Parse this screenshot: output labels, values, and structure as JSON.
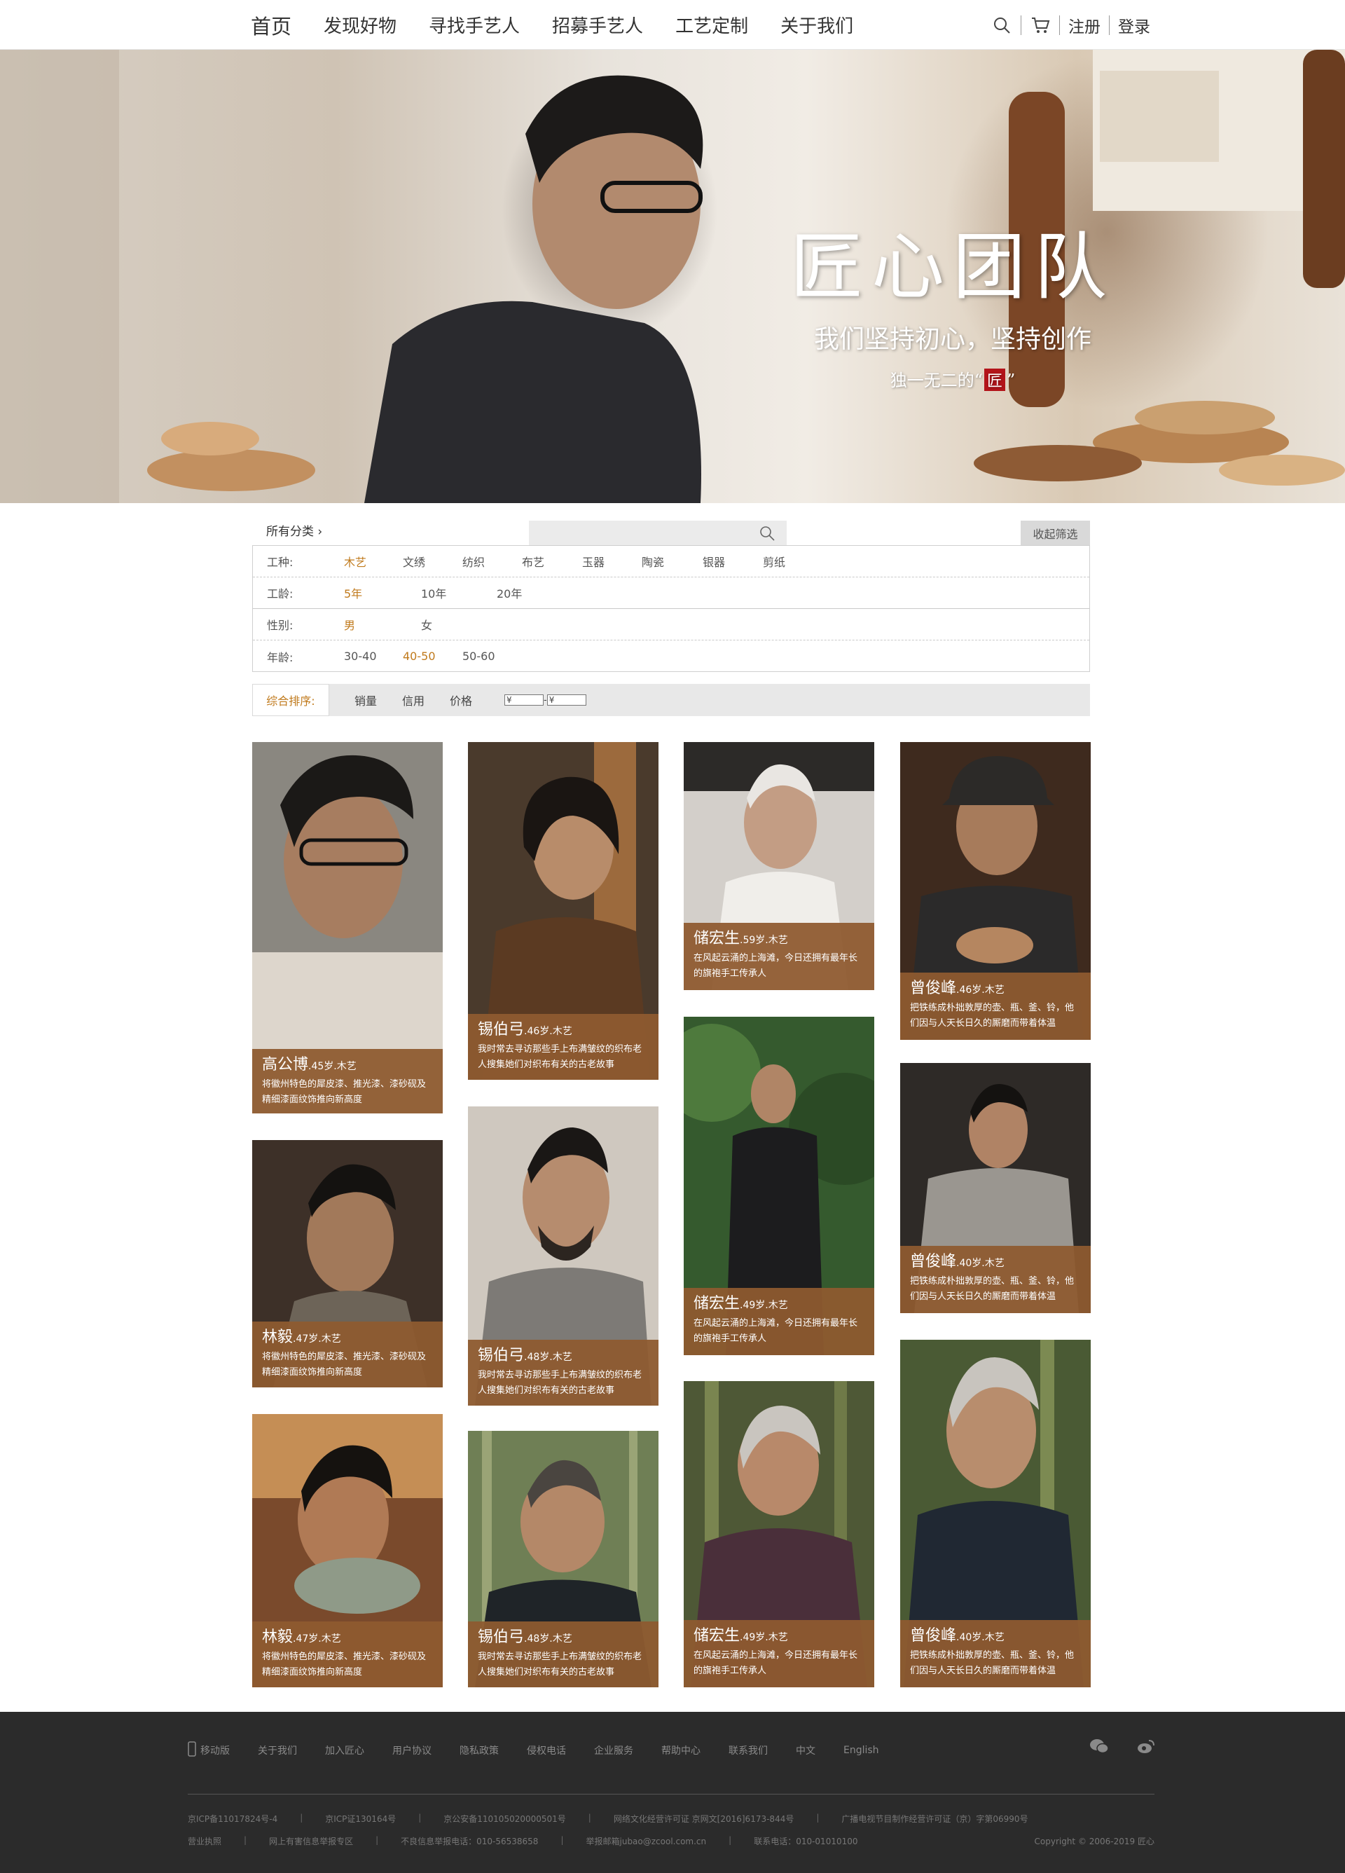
{
  "nav": {
    "items": [
      "首页",
      "发现好物",
      "寻找手艺人",
      "招募手艺人",
      "工艺定制",
      "关于我们"
    ],
    "register": "注册",
    "login": "登录"
  },
  "hero": {
    "title": "匠心团队",
    "subtitle": "我们坚持初心，坚持创作",
    "tagline_pre": "独一无二的“",
    "tagline_seal": "匠",
    "tagline_post": "”"
  },
  "filter": {
    "category_label": "所有分类",
    "search_placeholder": "",
    "collapse": "收起筛选",
    "rows": [
      {
        "label": "工种:",
        "options": [
          "木艺",
          "文绣",
          "纺织",
          "布艺",
          "玉器",
          "陶瓷",
          "银器",
          "剪纸"
        ],
        "active": 0
      },
      {
        "label": "工龄:",
        "options": [
          "5年",
          "10年",
          "20年"
        ],
        "active": 0
      },
      {
        "label": "性别:",
        "options": [
          "男",
          "女"
        ],
        "active": 0
      },
      {
        "label": "年龄:",
        "options": [
          "30-40",
          "40-50",
          "50-60"
        ],
        "active": 1
      }
    ]
  },
  "sort": {
    "active": "综合排序:",
    "options": [
      "销量",
      "信用",
      "价格"
    ],
    "price_from": "¥",
    "price_sep": "-",
    "price_to": "¥"
  },
  "cards": [
    {
      "name": "高公博",
      "meta": ".45岁.木艺",
      "desc": "将徽州特色的犀皮漆、推光漆、漆砂砚及精细漆面纹饰推向新高度"
    },
    {
      "name": "锡伯弓",
      "meta": ".46岁.木艺",
      "desc": "我时常去寻访那些手上布满皱纹的织布老人搜集她们对织布有关的古老故事"
    },
    {
      "name": "储宏生",
      "meta": ".59岁.木艺",
      "desc": "在风起云涌的上海滩，今日还拥有最年长的旗袍手工传承人"
    },
    {
      "name": "曾俊峰",
      "meta": ".46岁.木艺",
      "desc": "把铁练成朴拙敦厚的壶、瓶、釜、铃，他们因与人天长日久的厮磨而带着体温"
    },
    {
      "name": "林毅",
      "meta": ".47岁.木艺",
      "desc": "将徽州特色的犀皮漆、推光漆、漆砂砚及精细漆面纹饰推向新高度"
    },
    {
      "name": "锡伯弓",
      "meta": ".48岁.木艺",
      "desc": "我时常去寻访那些手上布满皱纹的织布老人搜集她们对织布有关的古老故事"
    },
    {
      "name": "储宏生",
      "meta": ".49岁.木艺",
      "desc": "在风起云涌的上海滩，今日还拥有最年长的旗袍手工传承人"
    },
    {
      "name": "曾俊峰",
      "meta": ".40岁.木艺",
      "desc": "把铁练成朴拙敦厚的壶、瓶、釜、铃，他们因与人天长日久的厮磨而带着体温"
    },
    {
      "name": "林毅",
      "meta": ".47岁.木艺",
      "desc": "将徽州特色的犀皮漆、推光漆、漆砂砚及精细漆面纹饰推向新高度"
    },
    {
      "name": "锡伯弓",
      "meta": ".48岁.木艺",
      "desc": "我时常去寻访那些手上布满皱纹的织布老人搜集她们对织布有关的古老故事"
    },
    {
      "name": "储宏生",
      "meta": ".49岁.木艺",
      "desc": "在风起云涌的上海滩，今日还拥有最年长的旗袍手工传承人"
    },
    {
      "name": "曾俊峰",
      "meta": ".40岁.木艺",
      "desc": "把铁练成朴拙敦厚的壶、瓶、釜、铃，他们因与人天长日久的厮磨而带着体温"
    }
  ],
  "footer": {
    "links": [
      "移动版",
      "关于我们",
      "加入匠心",
      "用户协议",
      "隐私政策",
      "侵权电话",
      "企业服务",
      "帮助中心",
      "联系我们",
      "中文",
      "English"
    ],
    "row1": [
      "京ICP备11017824号-4",
      "京ICP证130164号",
      "京公安备110105020000501号",
      "网络文化经营许可证 京网文[2016]6173-844号",
      "广播电视节目制作经营许可证（京）字第06990号"
    ],
    "row2": [
      "营业执照",
      "网上有害信息举报专区",
      "不良信息举报电话：010-56538658",
      "举报邮箱jubao@zcool.com.cn",
      "联系电话：010-01010100",
      "Copyright © 2006-2019 匠心"
    ]
  },
  "colors": {
    "accent": "#c07a1c",
    "card_overlay": "#8e5a30",
    "footer_bg": "#2b2b2b",
    "seal": "#b3141a"
  }
}
